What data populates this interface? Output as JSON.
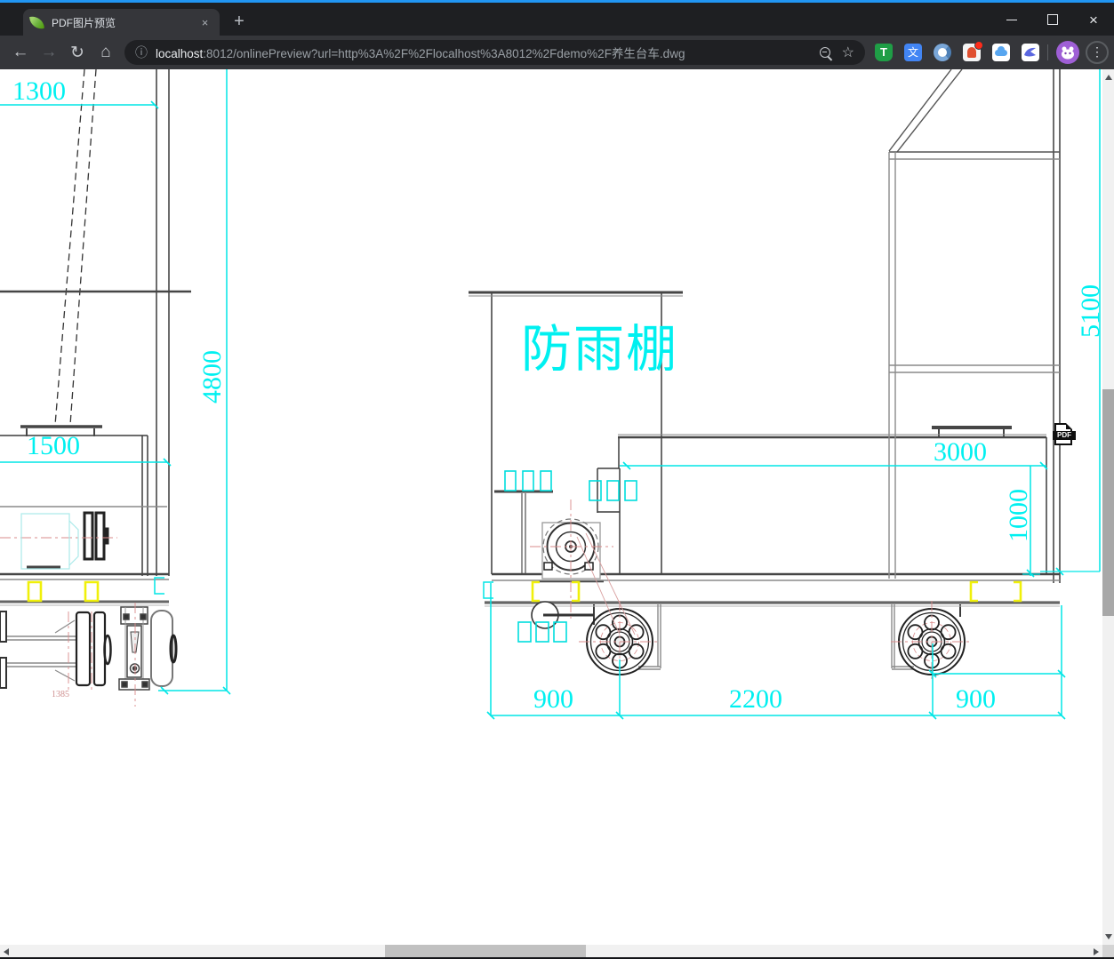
{
  "tab_bar": {
    "tab_title": "PDF图片预览",
    "close_glyph": "×",
    "new_tab_glyph": "+"
  },
  "toolbar": {
    "back_glyph": "←",
    "forward_glyph": "→",
    "reload_glyph": "↻",
    "home_glyph": "⌂",
    "site_info_glyph": "ⓘ",
    "bookmark_star_glyph": "☆",
    "menu_glyph": "⋮",
    "url": {
      "host": "localhost",
      "rest": ":8012/onlinePreview?url=http%3A%2F%2Flocalhost%3A8012%2Fdemo%2F养生台车.dwg"
    },
    "extensions": {
      "tampermonkey_letter": "T",
      "translate_glyph": "文"
    }
  },
  "icons": {
    "spring_leaf": "green-leaf-logo",
    "zoom_out": "magnifier-with-minus",
    "blue_ring_extension": "blue-ring",
    "red_badge_extension": "red-figure-with-badge",
    "cloud_extension": "blue-cloud",
    "bird_extension": "blue-bird",
    "avatar": "purple-panda-avatar"
  },
  "viewer": {
    "pdf_badge": "PDF"
  },
  "drawing": {
    "annotations": {
      "canopy": "防雨棚"
    },
    "dimensions": {
      "left_top_width": "1300",
      "left_platform_width": "1500",
      "left_height": "4800",
      "right_height": "5100",
      "deck_length": "3000",
      "deck_height": "1000",
      "wheel_left": "900",
      "wheel_mid": "2200",
      "wheel_right": "900",
      "axle_width": "1385"
    },
    "colors": {
      "dimension_cyan": "#00f0f0",
      "line_dark": "#3c3c3c",
      "highlight_yellow": "#f0f00a",
      "centerline_pink": "#d98b8b"
    }
  }
}
